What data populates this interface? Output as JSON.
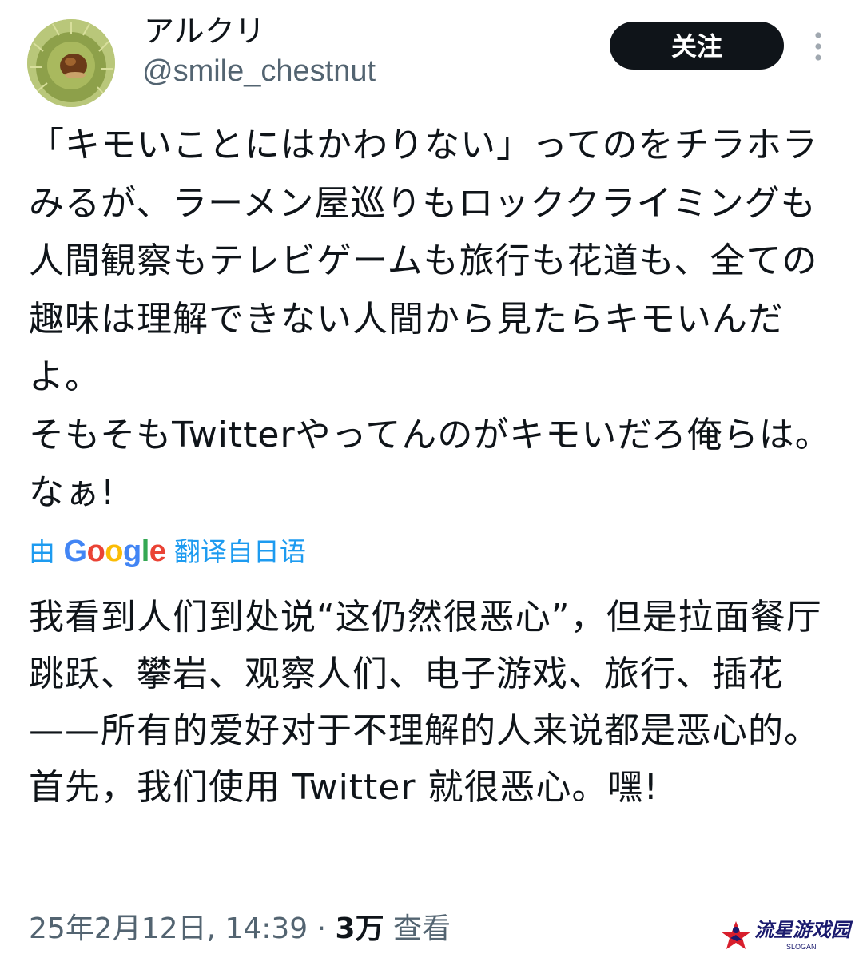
{
  "header": {
    "display_name": "アルクリ",
    "handle": "@smile_chestnut",
    "follow_label": "关注"
  },
  "tweet": {
    "original_text": "「キモいことにはかわりない」ってのをチラホラみるが、ラーメン屋巡りもロッククライミングも人間観察もテレビゲームも旅行も花道も、全ての趣味は理解できない人間から見たらキモいんだよ。\nそもそもTwitterやってんのがキモいだろ俺らは。なぁ!",
    "translation": {
      "prefix": "由",
      "brand": "Google",
      "suffix": "翻译自日语"
    },
    "translated_text": "我看到人们到处说“这仍然很恶心”，但是拉面餐厅跳跃、攀岩、观察人们、电子游戏、旅行、插花——所有的爱好对于不理解的人来说都是恶心的。\n首先，我们使用 Twitter 就很恶心。嘿!"
  },
  "meta": {
    "timestamp": "25年2月12日, 14:39",
    "separator": "·",
    "views_count": "3万",
    "views_label": "查看"
  },
  "watermark": {
    "title": "流星游戏园",
    "subtitle": "SLOGAN"
  },
  "colors": {
    "text_primary": "#0f1419",
    "text_secondary": "#536471",
    "link_blue": "#1d9bf0",
    "button_bg": "#0f1419"
  },
  "icons": {
    "more": "vertical-ellipsis-icon",
    "avatar": "chestnut-avatar"
  }
}
